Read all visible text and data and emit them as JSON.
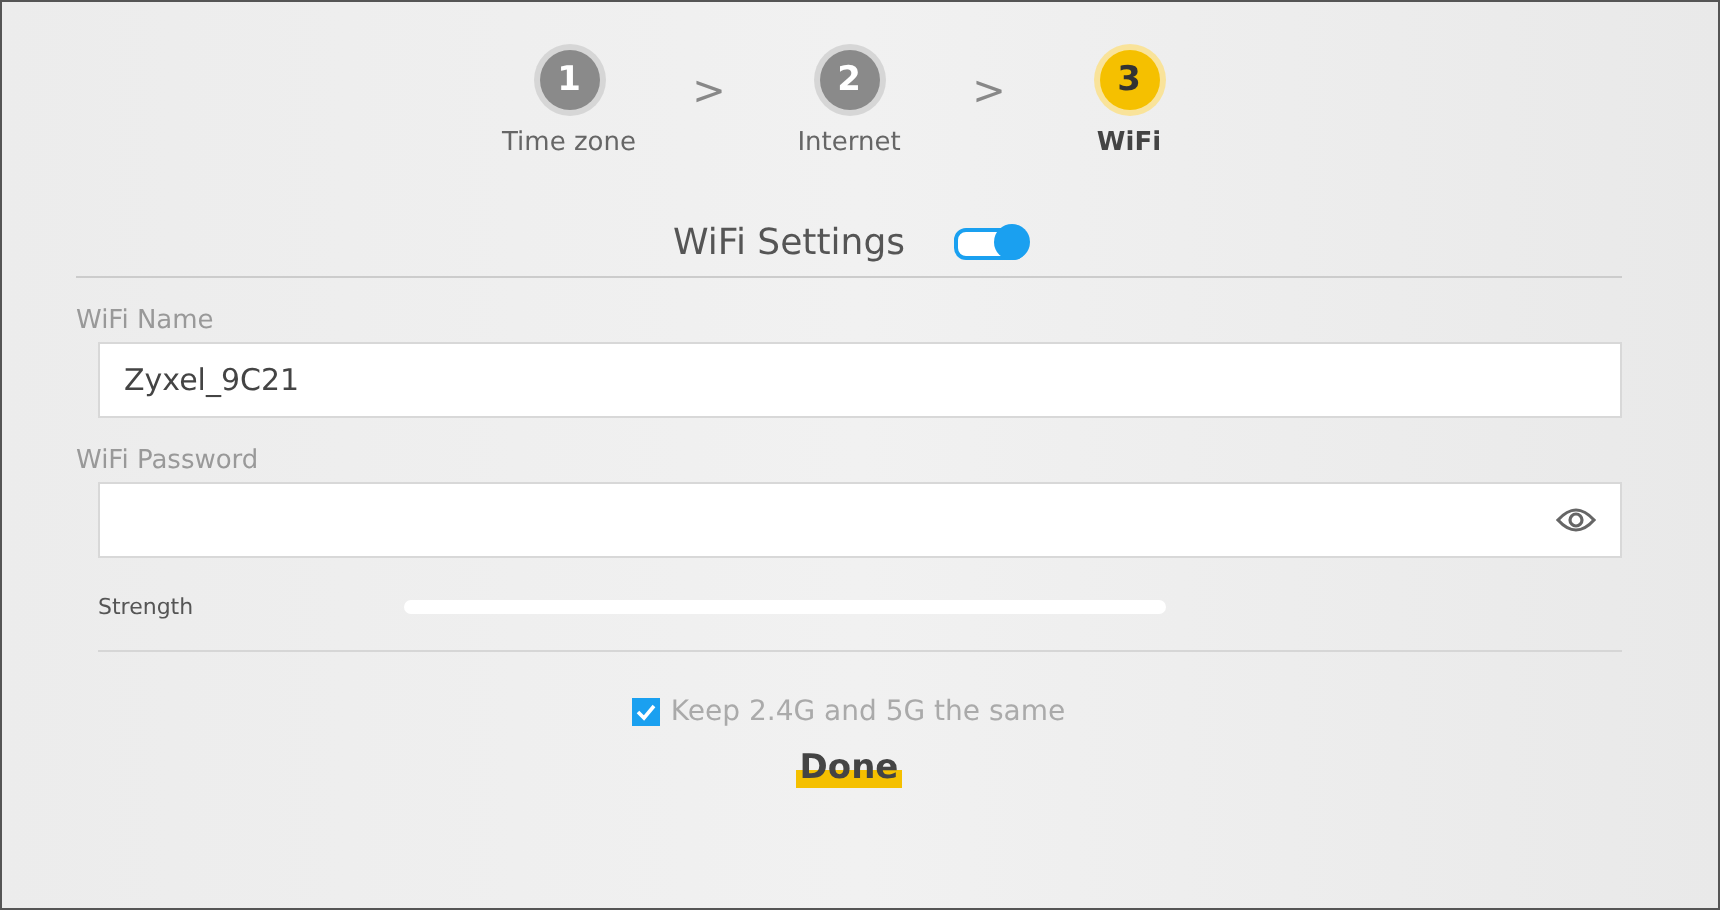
{
  "steps": [
    {
      "number": "1",
      "label": "Time zone",
      "selected": false
    },
    {
      "number": "2",
      "label": "Internet",
      "selected": false
    },
    {
      "number": "3",
      "label": "WiFi",
      "selected": true
    }
  ],
  "step_separator": ">",
  "section": {
    "title": "WiFi Settings",
    "on": true
  },
  "fields": [
    {
      "label": "WiFi Name",
      "value": "Zyxel_9C21",
      "kind": "text"
    },
    {
      "label": "WiFi Password",
      "kind": "password"
    }
  ],
  "strength": {
    "label": "Strength"
  },
  "same_settings": {
    "label": "Keep 2.4G and 5G the same",
    "checked": true
  },
  "done_button": "Done"
}
